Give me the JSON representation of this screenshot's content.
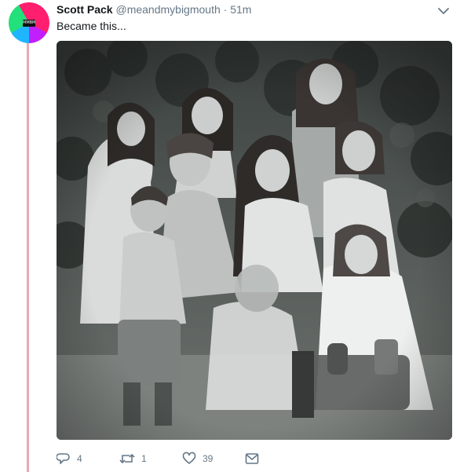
{
  "tweet": {
    "author_name": "Scott Pack",
    "handle": "@meandmybigmouth",
    "separator": "·",
    "time": "51m",
    "text": "Became this...",
    "photo_alt": "Old black and white photograph of a group of children posing in front of ivy",
    "avatar_badge": "MMBM",
    "actions": {
      "reply_count": "4",
      "retweet_count": "1",
      "like_count": "39"
    }
  },
  "colors": {
    "thread_line": "#e8aab2",
    "muted_text": "#657786",
    "primary_text": "#14171a"
  },
  "icons": [
    "chevron-down-icon",
    "reply-icon",
    "retweet-icon",
    "heart-icon",
    "message-icon"
  ]
}
